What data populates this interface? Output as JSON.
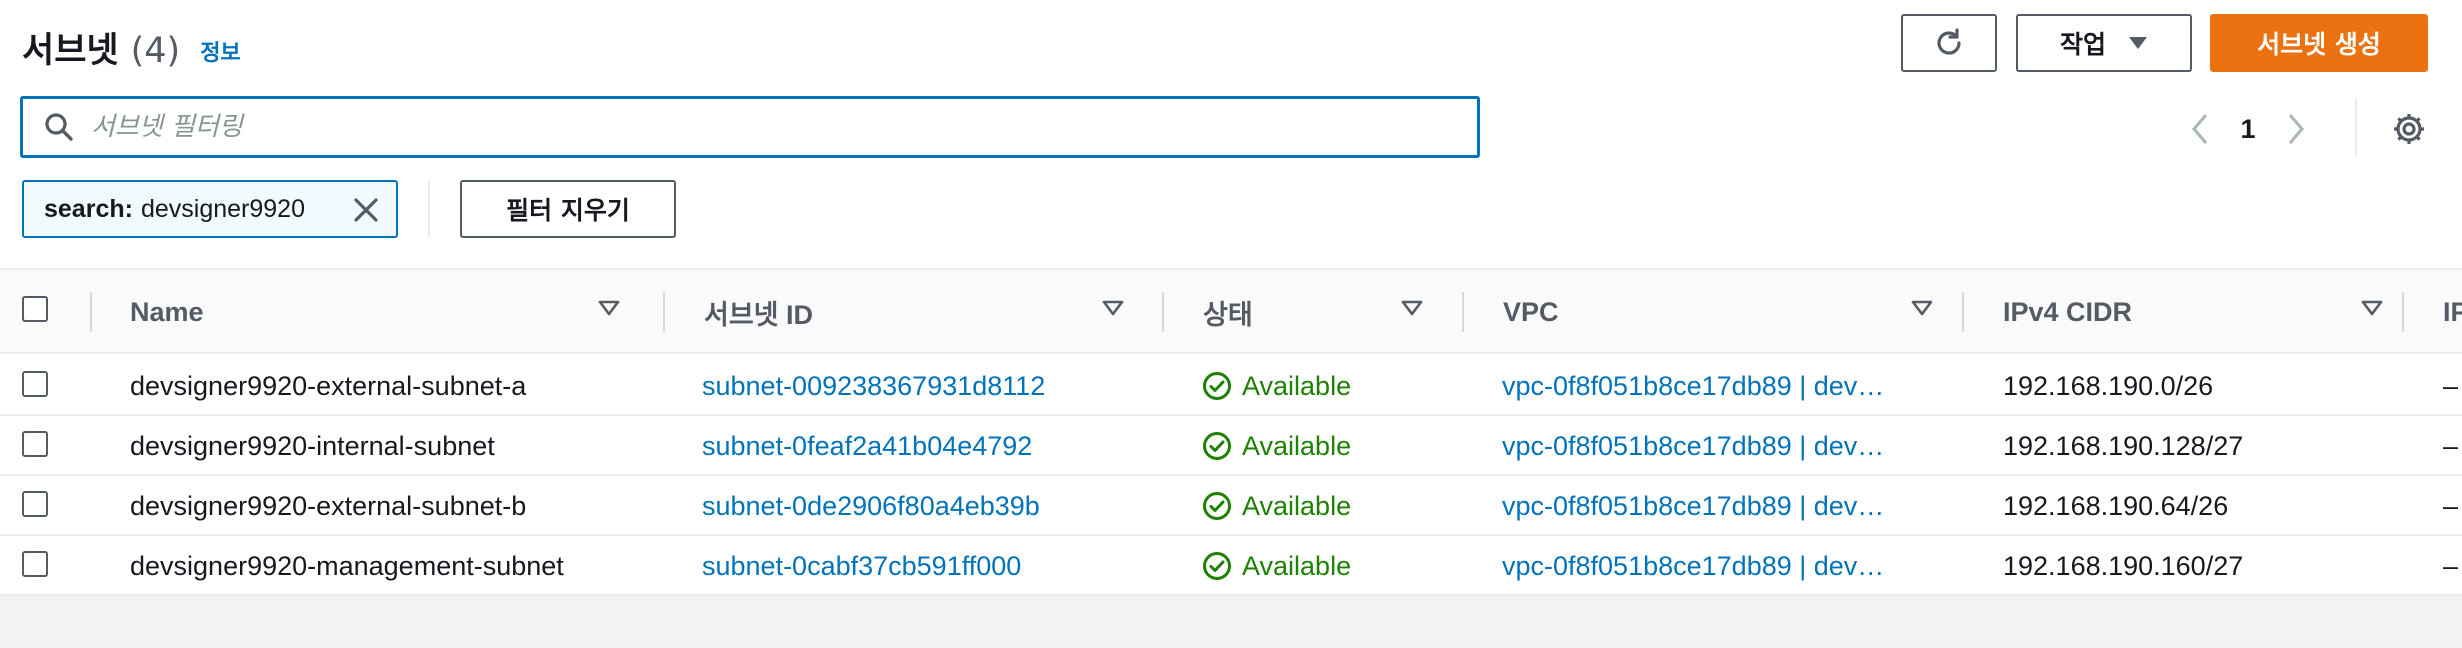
{
  "header": {
    "title": "서브넷",
    "count": "(4)",
    "info_link": "정보",
    "refresh_icon": "refresh-icon",
    "actions_label": "작업",
    "create_label": "서브넷 생성",
    "accent_color": "#ec7211"
  },
  "search": {
    "placeholder": "서브넷 필터링",
    "value": ""
  },
  "pagination": {
    "current_page": "1"
  },
  "filter_token": {
    "key": "search:",
    "value": "devsigner9920",
    "clear_label": "필터 지우기"
  },
  "table": {
    "columns": [
      "Name",
      "서브넷 ID",
      "상태",
      "VPC",
      "IPv4 CIDR",
      "IP"
    ],
    "rows": [
      {
        "name": "devsigner9920-external-subnet-a",
        "subnet_id": "subnet-009238367931d8112",
        "status": "Available",
        "vpc": "vpc-0f8f051b8ce17db89 | dev…",
        "cidr": "192.168.190.0/26",
        "ipv6": "–"
      },
      {
        "name": "devsigner9920-internal-subnet",
        "subnet_id": "subnet-0feaf2a41b04e4792",
        "status": "Available",
        "vpc": "vpc-0f8f051b8ce17db89 | dev…",
        "cidr": "192.168.190.128/27",
        "ipv6": "–"
      },
      {
        "name": "devsigner9920-external-subnet-b",
        "subnet_id": "subnet-0de2906f80a4eb39b",
        "status": "Available",
        "vpc": "vpc-0f8f051b8ce17db89 | dev…",
        "cidr": "192.168.190.64/26",
        "ipv6": "–"
      },
      {
        "name": "devsigner9920-management-subnet",
        "subnet_id": "subnet-0cabf37cb591ff000",
        "status": "Available",
        "vpc": "vpc-0f8f051b8ce17db89 | dev…",
        "cidr": "192.168.190.160/27",
        "ipv6": "–"
      }
    ]
  },
  "colors": {
    "link": "#0073bb",
    "available": "#1d8102"
  }
}
